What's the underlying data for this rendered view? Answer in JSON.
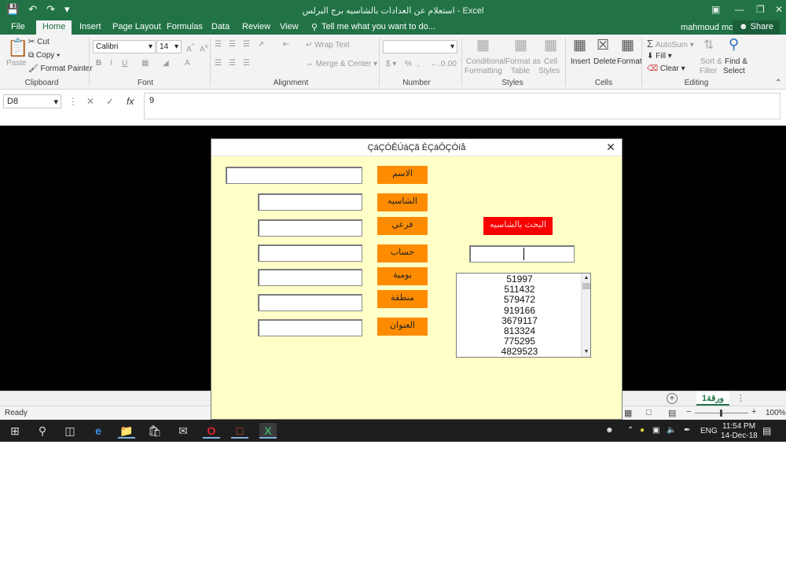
{
  "window": {
    "title": "استعلام عن العدادات بالشاسيه برج البرلس - Excel",
    "user": "mahmoud mouta",
    "share_label": "Share"
  },
  "tabs": [
    "File",
    "Home",
    "Insert",
    "Page Layout",
    "Formulas",
    "Data",
    "Review",
    "View"
  ],
  "tell_me": "Tell me what you want to do...",
  "ribbon": {
    "clipboard": {
      "paste": "Paste",
      "cut": "Cut",
      "copy": "Copy",
      "format_painter": "Format Painter",
      "label": "Clipboard"
    },
    "font": {
      "name": "Calibri",
      "size": "14",
      "label": "Font"
    },
    "alignment": {
      "wrap": "Wrap Text",
      "merge": "Merge & Center",
      "label": "Alignment"
    },
    "number": {
      "format": "",
      "percent": "%",
      "label": "Number"
    },
    "styles": {
      "conditional": "Conditional",
      "formatting": "Formatting",
      "format_as": "Format as",
      "table": "Table",
      "cell": "Cell",
      "cell_styles": "Styles",
      "label": "Styles"
    },
    "cells": {
      "insert": "Insert",
      "delete": "Delete",
      "format": "Format",
      "label": "Cells"
    },
    "editing": {
      "autosum": "AutoSum",
      "fill": "Fill",
      "clear": "Clear",
      "sort": "Sort &",
      "filter": "Filter",
      "find": "Find &",
      "select": "Select",
      "label": "Editing"
    }
  },
  "formula_bar": {
    "name_box": "D8",
    "fx": "fx",
    "value": "9"
  },
  "sheet_tab": "ورقة1",
  "status": {
    "ready": "Ready",
    "zoom": "100%"
  },
  "taskbar": {
    "time": "11:54 PM",
    "date": "14-Dec-18",
    "lang": "ENG"
  },
  "form": {
    "title": "ÇáÇÓÊÚáÇã ÈÇáÔÇÓíå",
    "labels": [
      "الاسم",
      "الشاسيه",
      "فرعي",
      "حساب",
      "يومية",
      "منطقة",
      "العنوان"
    ],
    "search_button": "البحث بالشاسيه",
    "list_items": [
      "51997",
      "511432",
      "579472",
      "919166",
      "3679117",
      "813324",
      "775295",
      "4829523"
    ]
  },
  "colors": {
    "excel_green": "#217346",
    "form_bg": "#ffffc8",
    "label_orange": "#ff8c00",
    "search_red": "#f90000"
  }
}
